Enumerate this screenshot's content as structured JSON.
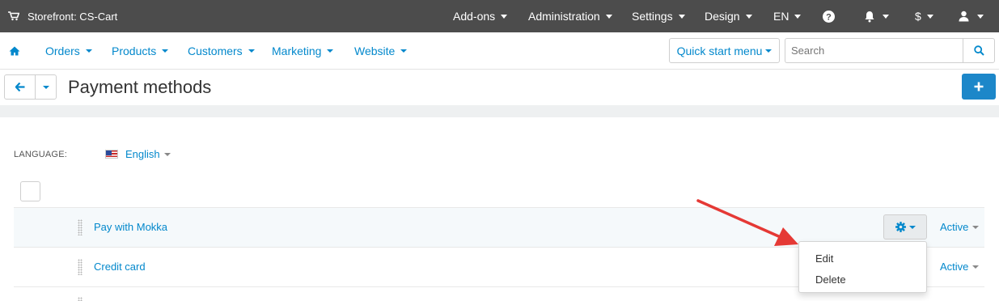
{
  "topbar": {
    "store_label": "Storefront: CS-Cart",
    "addons": "Add-ons",
    "administration": "Administration",
    "settings": "Settings",
    "design": "Design",
    "language": "EN",
    "currency": "$",
    "icons": [
      "cart-icon",
      "help-icon",
      "bell-icon",
      "user-icon"
    ]
  },
  "nav": {
    "orders": "Orders",
    "products": "Products",
    "customers": "Customers",
    "marketing": "Marketing",
    "website": "Website",
    "quick_start": "Quick start menu",
    "search_placeholder": "Search"
  },
  "title": {
    "page_title": "Payment methods"
  },
  "content": {
    "language_label": "LANGUAGE:",
    "language_value": "English",
    "rows": [
      {
        "name": "Pay with Mokka",
        "status": "Active"
      },
      {
        "name": "Credit card",
        "status": "Active"
      }
    ],
    "dropdown": {
      "edit": "Edit",
      "delete": "Delete"
    }
  },
  "colors": {
    "topbar_bg": "#4c4c4c",
    "link_blue": "#0388cc",
    "primary_button": "#1c87c9",
    "arrow_red": "#e53935"
  }
}
